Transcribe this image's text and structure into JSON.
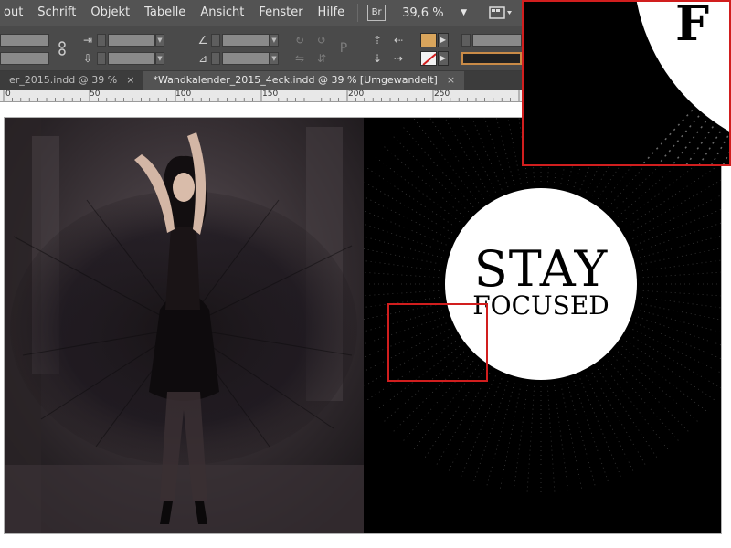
{
  "menubar": {
    "items": [
      "out",
      "Schrift",
      "Objekt",
      "Tabelle",
      "Ansicht",
      "Fenster",
      "Hilfe"
    ],
    "bridge_label": "Br",
    "zoom": "39,6 %"
  },
  "tabs": [
    {
      "label": "er_2015.indd @ 39 %",
      "active": false
    },
    {
      "label": "*Wandkalender_2015_4eck.indd @ 39 % [Umgewandelt]",
      "active": true
    }
  ],
  "tab_close": "×",
  "ruler": {
    "labels": [
      "0",
      "50",
      "100",
      "150",
      "200",
      "250"
    ]
  },
  "document": {
    "headline": "STAY",
    "subline": "FOCUSED",
    "inset_letter": "F"
  },
  "colors": {
    "fill_swatch": "#d9a55c",
    "stroke_swatch": "#ffffff",
    "selection": "#d11e1e",
    "page_background": "#000000"
  },
  "icons": {
    "proxy_reference": "link-chain-icon",
    "rotate_cw": "rotate-cw-icon",
    "rotate_ccw": "rotate-ccw-icon",
    "flip_horizontal": "flip-horizontal-icon",
    "flip_vertical": "flip-vertical-icon",
    "select_container": "select-container-icon",
    "select_content": "select-content-icon",
    "view_options": "screen-mode-icon",
    "arrange_documents": "arrange-documents-icon"
  }
}
